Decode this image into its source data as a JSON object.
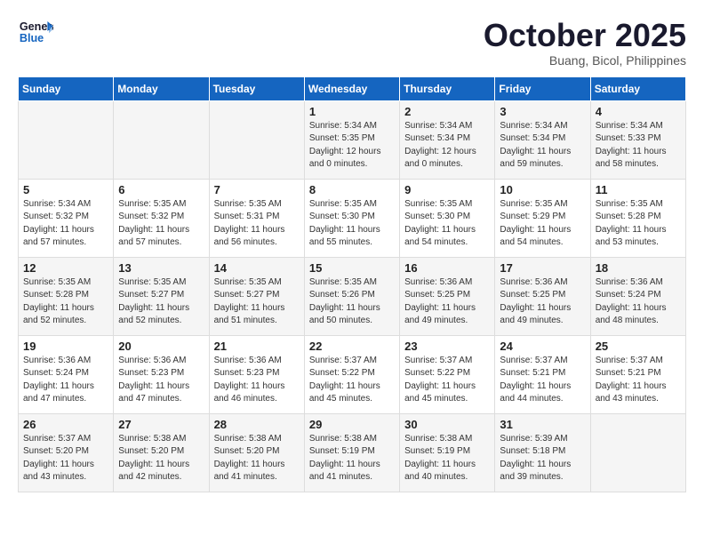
{
  "header": {
    "logo_line1": "General",
    "logo_line2": "Blue",
    "month": "October 2025",
    "location": "Buang, Bicol, Philippines"
  },
  "weekdays": [
    "Sunday",
    "Monday",
    "Tuesday",
    "Wednesday",
    "Thursday",
    "Friday",
    "Saturday"
  ],
  "weeks": [
    [
      {
        "day": "",
        "info": ""
      },
      {
        "day": "",
        "info": ""
      },
      {
        "day": "",
        "info": ""
      },
      {
        "day": "1",
        "info": "Sunrise: 5:34 AM\nSunset: 5:35 PM\nDaylight: 12 hours\nand 0 minutes."
      },
      {
        "day": "2",
        "info": "Sunrise: 5:34 AM\nSunset: 5:34 PM\nDaylight: 12 hours\nand 0 minutes."
      },
      {
        "day": "3",
        "info": "Sunrise: 5:34 AM\nSunset: 5:34 PM\nDaylight: 11 hours\nand 59 minutes."
      },
      {
        "day": "4",
        "info": "Sunrise: 5:34 AM\nSunset: 5:33 PM\nDaylight: 11 hours\nand 58 minutes."
      }
    ],
    [
      {
        "day": "5",
        "info": "Sunrise: 5:34 AM\nSunset: 5:32 PM\nDaylight: 11 hours\nand 57 minutes."
      },
      {
        "day": "6",
        "info": "Sunrise: 5:35 AM\nSunset: 5:32 PM\nDaylight: 11 hours\nand 57 minutes."
      },
      {
        "day": "7",
        "info": "Sunrise: 5:35 AM\nSunset: 5:31 PM\nDaylight: 11 hours\nand 56 minutes."
      },
      {
        "day": "8",
        "info": "Sunrise: 5:35 AM\nSunset: 5:30 PM\nDaylight: 11 hours\nand 55 minutes."
      },
      {
        "day": "9",
        "info": "Sunrise: 5:35 AM\nSunset: 5:30 PM\nDaylight: 11 hours\nand 54 minutes."
      },
      {
        "day": "10",
        "info": "Sunrise: 5:35 AM\nSunset: 5:29 PM\nDaylight: 11 hours\nand 54 minutes."
      },
      {
        "day": "11",
        "info": "Sunrise: 5:35 AM\nSunset: 5:28 PM\nDaylight: 11 hours\nand 53 minutes."
      }
    ],
    [
      {
        "day": "12",
        "info": "Sunrise: 5:35 AM\nSunset: 5:28 PM\nDaylight: 11 hours\nand 52 minutes."
      },
      {
        "day": "13",
        "info": "Sunrise: 5:35 AM\nSunset: 5:27 PM\nDaylight: 11 hours\nand 52 minutes."
      },
      {
        "day": "14",
        "info": "Sunrise: 5:35 AM\nSunset: 5:27 PM\nDaylight: 11 hours\nand 51 minutes."
      },
      {
        "day": "15",
        "info": "Sunrise: 5:35 AM\nSunset: 5:26 PM\nDaylight: 11 hours\nand 50 minutes."
      },
      {
        "day": "16",
        "info": "Sunrise: 5:36 AM\nSunset: 5:25 PM\nDaylight: 11 hours\nand 49 minutes."
      },
      {
        "day": "17",
        "info": "Sunrise: 5:36 AM\nSunset: 5:25 PM\nDaylight: 11 hours\nand 49 minutes."
      },
      {
        "day": "18",
        "info": "Sunrise: 5:36 AM\nSunset: 5:24 PM\nDaylight: 11 hours\nand 48 minutes."
      }
    ],
    [
      {
        "day": "19",
        "info": "Sunrise: 5:36 AM\nSunset: 5:24 PM\nDaylight: 11 hours\nand 47 minutes."
      },
      {
        "day": "20",
        "info": "Sunrise: 5:36 AM\nSunset: 5:23 PM\nDaylight: 11 hours\nand 47 minutes."
      },
      {
        "day": "21",
        "info": "Sunrise: 5:36 AM\nSunset: 5:23 PM\nDaylight: 11 hours\nand 46 minutes."
      },
      {
        "day": "22",
        "info": "Sunrise: 5:37 AM\nSunset: 5:22 PM\nDaylight: 11 hours\nand 45 minutes."
      },
      {
        "day": "23",
        "info": "Sunrise: 5:37 AM\nSunset: 5:22 PM\nDaylight: 11 hours\nand 45 minutes."
      },
      {
        "day": "24",
        "info": "Sunrise: 5:37 AM\nSunset: 5:21 PM\nDaylight: 11 hours\nand 44 minutes."
      },
      {
        "day": "25",
        "info": "Sunrise: 5:37 AM\nSunset: 5:21 PM\nDaylight: 11 hours\nand 43 minutes."
      }
    ],
    [
      {
        "day": "26",
        "info": "Sunrise: 5:37 AM\nSunset: 5:20 PM\nDaylight: 11 hours\nand 43 minutes."
      },
      {
        "day": "27",
        "info": "Sunrise: 5:38 AM\nSunset: 5:20 PM\nDaylight: 11 hours\nand 42 minutes."
      },
      {
        "day": "28",
        "info": "Sunrise: 5:38 AM\nSunset: 5:20 PM\nDaylight: 11 hours\nand 41 minutes."
      },
      {
        "day": "29",
        "info": "Sunrise: 5:38 AM\nSunset: 5:19 PM\nDaylight: 11 hours\nand 41 minutes."
      },
      {
        "day": "30",
        "info": "Sunrise: 5:38 AM\nSunset: 5:19 PM\nDaylight: 11 hours\nand 40 minutes."
      },
      {
        "day": "31",
        "info": "Sunrise: 5:39 AM\nSunset: 5:18 PM\nDaylight: 11 hours\nand 39 minutes."
      },
      {
        "day": "",
        "info": ""
      }
    ]
  ]
}
